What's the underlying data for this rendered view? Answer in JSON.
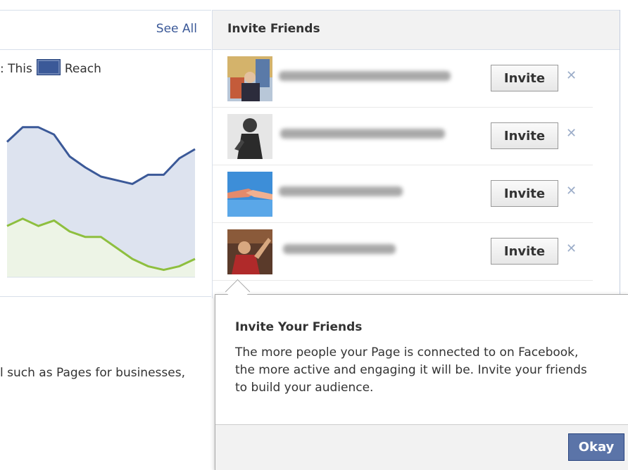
{
  "left_panel": {
    "see_all_label": "See All",
    "legend_prefix": ": This",
    "legend_label": "Reach",
    "side_text": "l such as Pages for businesses,",
    "chart_data": {
      "type": "area",
      "x": [
        0,
        1,
        2,
        3,
        4,
        5,
        6,
        7,
        8,
        9,
        10,
        11,
        12
      ],
      "series": [
        {
          "name": "Reach",
          "color": "#3b5998",
          "fill": "#dde3ef",
          "values": [
            74,
            82,
            82,
            78,
            66,
            60,
            55,
            53,
            51,
            56,
            56,
            65,
            70
          ]
        },
        {
          "name": "",
          "color": "#8ebf3f",
          "fill": "#edf4e6",
          "values": [
            28,
            32,
            28,
            31,
            25,
            22,
            22,
            16,
            10,
            6,
            4,
            6,
            10
          ]
        }
      ],
      "ylim": [
        0,
        100
      ],
      "grid": false,
      "legend": "top"
    }
  },
  "invite_panel": {
    "title": "Invite Friends",
    "friends": [
      {
        "button_label": "Invite",
        "dismiss_icon": "close-icon"
      },
      {
        "button_label": "Invite",
        "dismiss_icon": "close-icon"
      },
      {
        "button_label": "Invite",
        "dismiss_icon": "close-icon"
      },
      {
        "button_label": "Invite",
        "dismiss_icon": "close-icon"
      }
    ]
  },
  "popup": {
    "title": "Invite Your Friends",
    "text": "The more people your Page is connected to on Facebook, the more active and engaging it will be. Invite your friends to build your audience.",
    "okay_label": "Okay"
  },
  "colors": {
    "brand": "#3b5998",
    "button_blue": "#5b74a8",
    "secondary_series": "#8ebf3f"
  }
}
